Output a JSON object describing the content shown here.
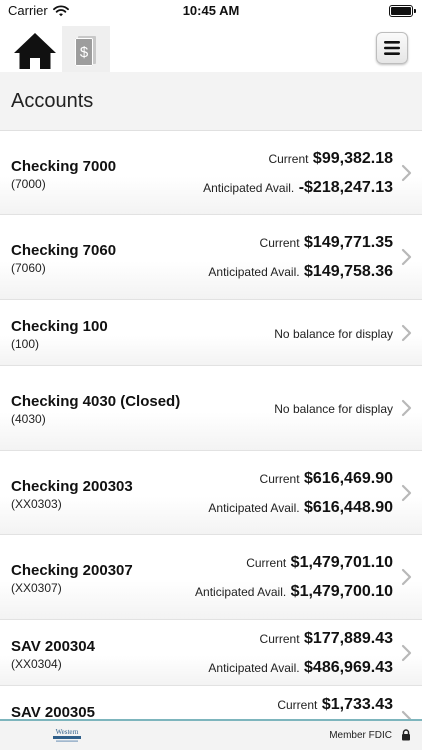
{
  "status_bar": {
    "carrier": "Carrier",
    "time": "10:45 AM"
  },
  "toolbar": {
    "home_icon": "home-icon",
    "money_icon": "dollar-bill-icon",
    "menu_icon": "hamburger-menu-icon"
  },
  "header": {
    "title": "Accounts"
  },
  "accounts": [
    {
      "name": "Checking 7000",
      "number": "(7000)",
      "current_label": "Current",
      "current": "$99,382.18",
      "anticipated_label": "Anticipated Avail.",
      "anticipated": "-$218,247.13"
    },
    {
      "name": "Checking 7060",
      "number": "(7060)",
      "current_label": "Current",
      "current": "$149,771.35",
      "anticipated_label": "Anticipated Avail.",
      "anticipated": "$149,758.36"
    },
    {
      "name": "Checking 100",
      "number": "(100)",
      "no_balance": "No balance for display"
    },
    {
      "name": "Checking 4030 (Closed)",
      "number": "(4030)",
      "no_balance": "No balance for display"
    },
    {
      "name": "Checking 200303",
      "number": "(XX0303)",
      "current_label": "Current",
      "current": "$616,469.90",
      "anticipated_label": "Anticipated Avail.",
      "anticipated": "$616,448.90"
    },
    {
      "name": "Checking 200307",
      "number": "(XX0307)",
      "current_label": "Current",
      "current": "$1,479,701.10",
      "anticipated_label": "Anticipated Avail.",
      "anticipated": "$1,479,700.10"
    },
    {
      "name": "SAV 200304",
      "number": "(XX0304)",
      "current_label": "Current",
      "current": "$177,889.43",
      "anticipated_label": "Anticipated Avail.",
      "anticipated": "$486,969.43"
    },
    {
      "name": "SAV 200305",
      "current_label": "Current",
      "current": "$1,733.43"
    }
  ],
  "footer": {
    "logo": "Western",
    "fdic": "Member FDIC"
  },
  "colors": {
    "footer_accent": "#7db5bd",
    "logo_blue": "#2f5f8a"
  }
}
